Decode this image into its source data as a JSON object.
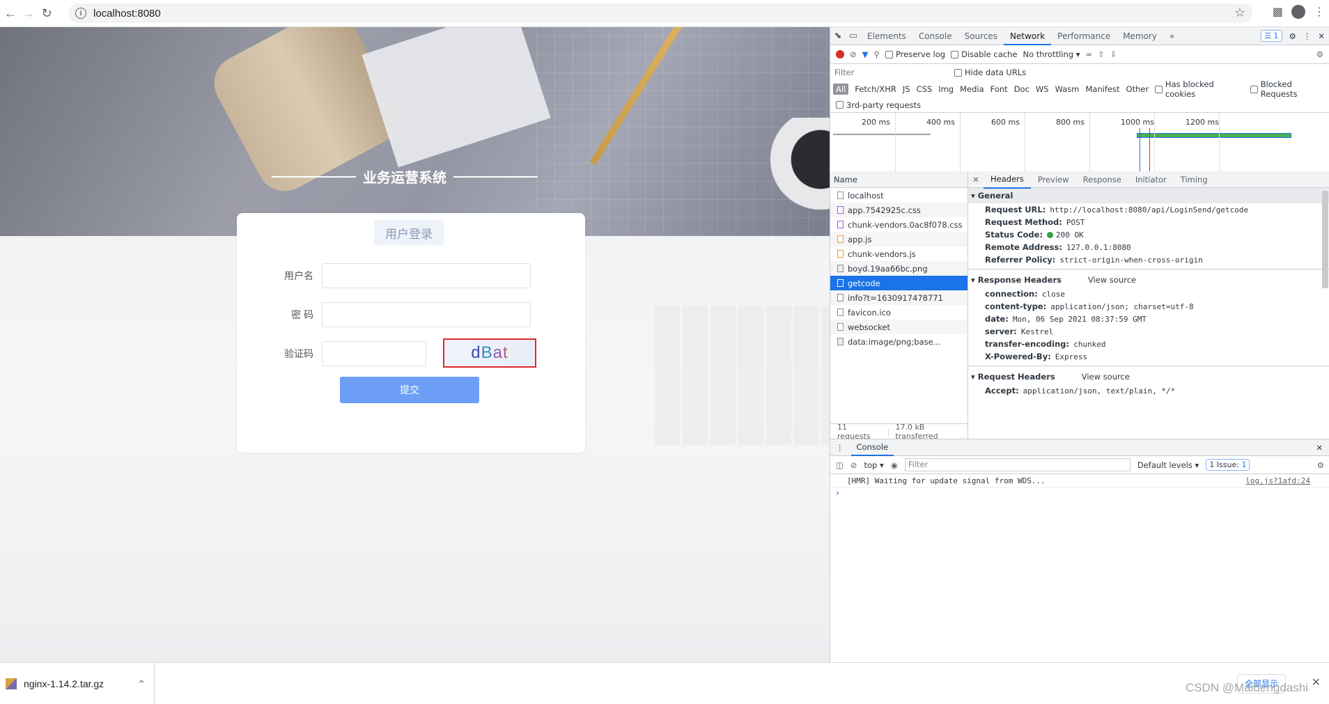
{
  "browser": {
    "url": "localhost:8080",
    "icons": {
      "back": "arrow-left-icon",
      "forward": "arrow-right-icon",
      "reload": "reload-icon",
      "info": "info-icon",
      "star": "star-icon",
      "extensions": "puzzle-icon",
      "profile": "avatar-icon",
      "menu": "kebab-menu-icon"
    }
  },
  "page": {
    "site_title": "业务运营系统",
    "login": {
      "header": "用户登录",
      "username_label": "用户名",
      "password_label": "密 码",
      "captcha_label": "验证码",
      "username_value": "",
      "password_value": "",
      "captcha_value": "",
      "captcha_image_text": "dBat",
      "submit_label": "提交"
    }
  },
  "devtools": {
    "tabs": [
      "Elements",
      "Console",
      "Sources",
      "Network",
      "Performance",
      "Memory"
    ],
    "active_tab": "Network",
    "more_tabs": "»",
    "issue_count": "1",
    "toolbar": {
      "preserve_log": "Preserve log",
      "disable_cache": "Disable cache",
      "throttling": "No throttling"
    },
    "filter": {
      "placeholder": "Filter",
      "hide_data_urls": "Hide data URLs",
      "types": [
        "All",
        "Fetch/XHR",
        "JS",
        "CSS",
        "Img",
        "Media",
        "Font",
        "Doc",
        "WS",
        "Wasm",
        "Manifest",
        "Other"
      ],
      "has_blocked_cookies": "Has blocked cookies",
      "blocked_requests": "Blocked Requests",
      "third_party": "3rd-party requests"
    },
    "timeline_ticks": [
      "200 ms",
      "400 ms",
      "600 ms",
      "800 ms",
      "1000 ms",
      "1200 ms"
    ],
    "requests_header": "Name",
    "requests": [
      {
        "name": "localhost",
        "type": "doc"
      },
      {
        "name": "app.7542925c.css",
        "type": "css"
      },
      {
        "name": "chunk-vendors.0ac8f078.css",
        "type": "css"
      },
      {
        "name": "app.js",
        "type": "js"
      },
      {
        "name": "chunk-vendors.js",
        "type": "js"
      },
      {
        "name": "boyd.19aa66bc.png",
        "type": "img"
      },
      {
        "name": "getcode",
        "type": "xhr",
        "selected": true
      },
      {
        "name": "info?t=1630917478771",
        "type": "xhr"
      },
      {
        "name": "favicon.ico",
        "type": "other"
      },
      {
        "name": "websocket",
        "type": "other"
      },
      {
        "name": "data:image/png;base...",
        "type": "img"
      }
    ],
    "summary": {
      "requests": "11 requests",
      "transferred": "17.0 kB transferred"
    },
    "detail_tabs": [
      "Headers",
      "Preview",
      "Response",
      "Initiator",
      "Timing"
    ],
    "general": {
      "title": "General",
      "rows": [
        {
          "k": "Request URL:",
          "v": "http://localhost:8080/api/LoginSend/getcode"
        },
        {
          "k": "Request Method:",
          "v": "POST"
        },
        {
          "k": "Status Code:",
          "v": "200 OK"
        },
        {
          "k": "Remote Address:",
          "v": "127.0.0.1:8080"
        },
        {
          "k": "Referrer Policy:",
          "v": "strict-origin-when-cross-origin"
        }
      ]
    },
    "response_headers": {
      "title": "Response Headers",
      "view_source": "View source",
      "rows": [
        {
          "k": "connection:",
          "v": "close"
        },
        {
          "k": "content-type:",
          "v": "application/json; charset=utf-8"
        },
        {
          "k": "date:",
          "v": "Mon, 06 Sep 2021 08:37:59 GMT"
        },
        {
          "k": "server:",
          "v": "Kestrel"
        },
        {
          "k": "transfer-encoding:",
          "v": "chunked"
        },
        {
          "k": "X-Powered-By:",
          "v": "Express"
        }
      ]
    },
    "request_headers": {
      "title": "Request Headers",
      "view_source": "View source",
      "rows": [
        {
          "k": "Accept:",
          "v": "application/json, text/plain, */*"
        }
      ]
    },
    "console": {
      "tab": "Console",
      "context": "top",
      "filter_placeholder": "Filter",
      "levels": "Default levels",
      "issues": "1 Issue:",
      "issues_count": "1",
      "messages": [
        {
          "text": "[HMR] Waiting for update signal from WDS...",
          "source": "log.js?1afd:24"
        }
      ]
    }
  },
  "downloads": {
    "file": "nginx-1.14.2.tar.gz",
    "show_all": "全部显示",
    "watermark": "CSDN @Maidengdashi"
  },
  "colors": {
    "accent": "#1a73e8",
    "submit": "#6d9ef5",
    "captcha_border": "#e0282e",
    "record": "#d93025"
  }
}
